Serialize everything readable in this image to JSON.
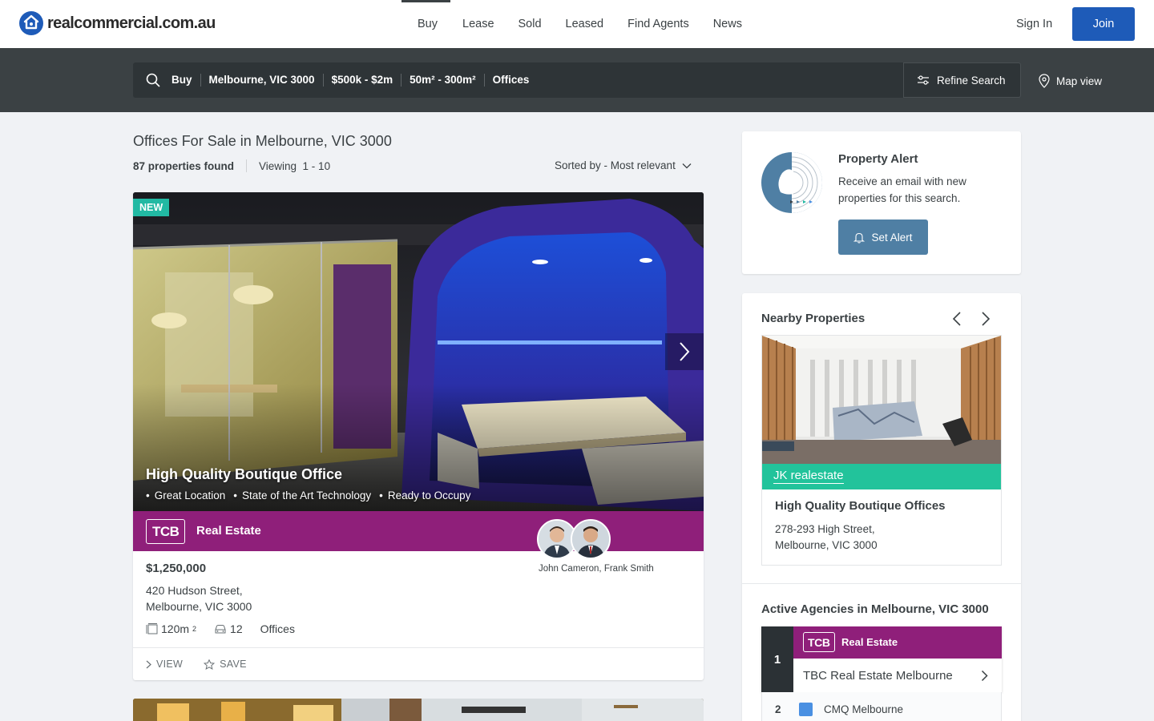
{
  "header": {
    "logo_text": "realcommercial.com.au",
    "nav": [
      "Buy",
      "Lease",
      "Sold",
      "Leased",
      "Find Agents",
      "News"
    ],
    "active_nav": "Buy",
    "sign_in": "Sign In",
    "join": "Join",
    "brand_color": "#1e5bb8"
  },
  "search": {
    "crumbs": [
      "Buy",
      "Melbourne, VIC 3000",
      "$500k - $2m",
      "50m² - 300m²",
      "Offices"
    ],
    "refine_label": "Refine Search",
    "map_label": "Map view"
  },
  "results": {
    "title": "Offices For Sale in Melbourne, VIC 3000",
    "count": "87 properties found",
    "viewing": "Viewing  1 - 10",
    "sort": "Sorted by - Most relevant"
  },
  "listing": {
    "badge": "NEW",
    "headline": "High Quality Boutique Office",
    "features": [
      "Great Location",
      "State of the Art Technology",
      "Ready to Occupy"
    ],
    "agency_logo": "TCB",
    "agency_name": "Real Estate",
    "agency_color": "#8f1f7a",
    "agents": "John Cameron, Frank Smith",
    "price": "$1,250,000",
    "address_line1": "420 Hudson Street,",
    "address_line2": "Melbourne, VIC 3000",
    "area": "120m",
    "area_sup": "2",
    "carspaces": "12",
    "type": "Offices",
    "view_label": "VIEW",
    "save_label": "SAVE"
  },
  "alert": {
    "title": "Property Alert",
    "description": "Receive an email with new properties for this search.",
    "button": "Set Alert"
  },
  "nearby": {
    "title": "Nearby Properties",
    "agency": "JK realestate",
    "name": "High Quality Boutique Offices",
    "address_line1": "278-293 High Street,",
    "address_line2": "Melbourne, VIC 3000"
  },
  "agencies": {
    "title": "Active Agencies in Melbourne, VIC 3000",
    "items": [
      {
        "rank": "1",
        "logo": "TCB",
        "logo_name": "Real Estate",
        "name": "TBC Real Estate Melbourne"
      },
      {
        "rank": "2",
        "name": "CMQ Melbourne"
      }
    ]
  }
}
